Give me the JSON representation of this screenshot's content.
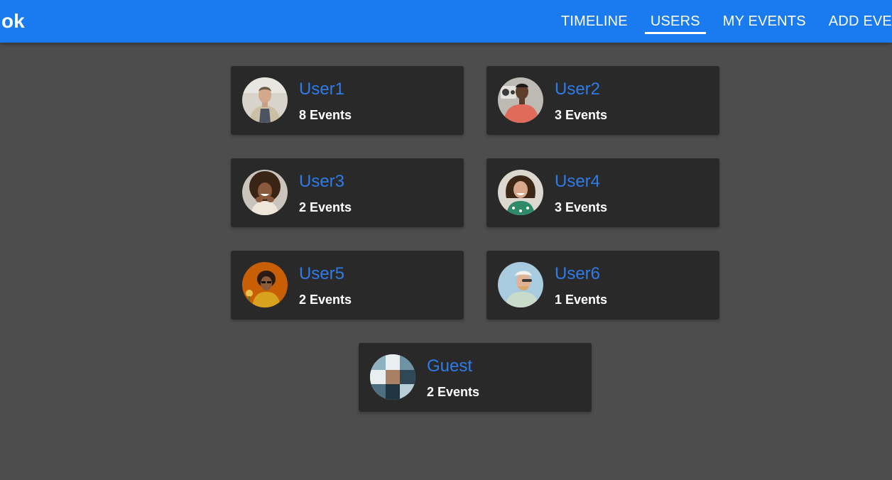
{
  "header": {
    "brand": "ok",
    "nav": [
      {
        "label": "TIMELINE",
        "active": false
      },
      {
        "label": "USERS",
        "active": true
      },
      {
        "label": "MY EVENTS",
        "active": false
      },
      {
        "label": "ADD EVENT",
        "active": false
      }
    ]
  },
  "users": [
    {
      "name": "User1",
      "events": "8 Events"
    },
    {
      "name": "User2",
      "events": "3 Events"
    },
    {
      "name": "User3",
      "events": "2 Events"
    },
    {
      "name": "User4",
      "events": "3 Events"
    },
    {
      "name": "User5",
      "events": "2 Events"
    },
    {
      "name": "User6",
      "events": "1 Events"
    },
    {
      "name": "Guest",
      "events": "2 Events"
    }
  ],
  "colors": {
    "header_bg": "#1a7bf0",
    "page_bg": "#4d4d4d",
    "card_bg": "#292929",
    "user_name": "#2f7be8",
    "event_count": "#ffffff"
  }
}
